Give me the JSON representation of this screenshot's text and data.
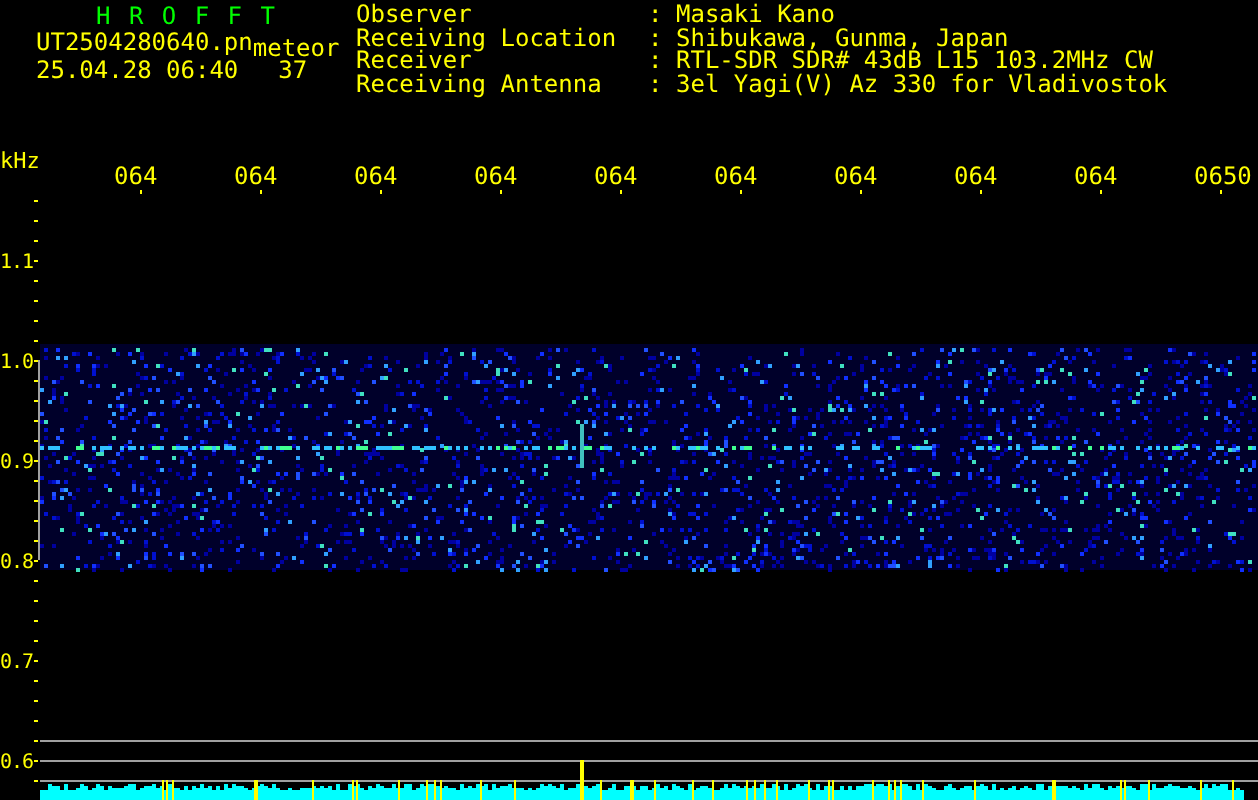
{
  "header": {
    "program": "H R O F F T",
    "file": "UT2504280640.pn",
    "mode": "meteor",
    "datetime": "25.04.28 06:40",
    "count": "37"
  },
  "info": [
    {
      "label": "Observer",
      "separator": ":",
      "value": "Masaki Kano"
    },
    {
      "label": "Receiving Location",
      "separator": ":",
      "value": "Shibukawa, Gunma, Japan"
    },
    {
      "label": "Receiver",
      "separator": ":",
      "value": "RTL-SDR SDR# 43dB L15 103.2MHz CW"
    },
    {
      "label": "Receiving Antenna",
      "separator": ":",
      "value": "3el Yagi(V) Az 330 for Vladivostok"
    }
  ],
  "plot": {
    "y_unit": "kHz",
    "time_labels": [
      "064",
      "064",
      "064",
      "064",
      "064",
      "064",
      "064",
      "064",
      "064",
      "0650"
    ],
    "y_labels": [
      "1.1",
      "1.0",
      "0.9",
      "0.8",
      "0.7",
      "0.6"
    ]
  }
}
